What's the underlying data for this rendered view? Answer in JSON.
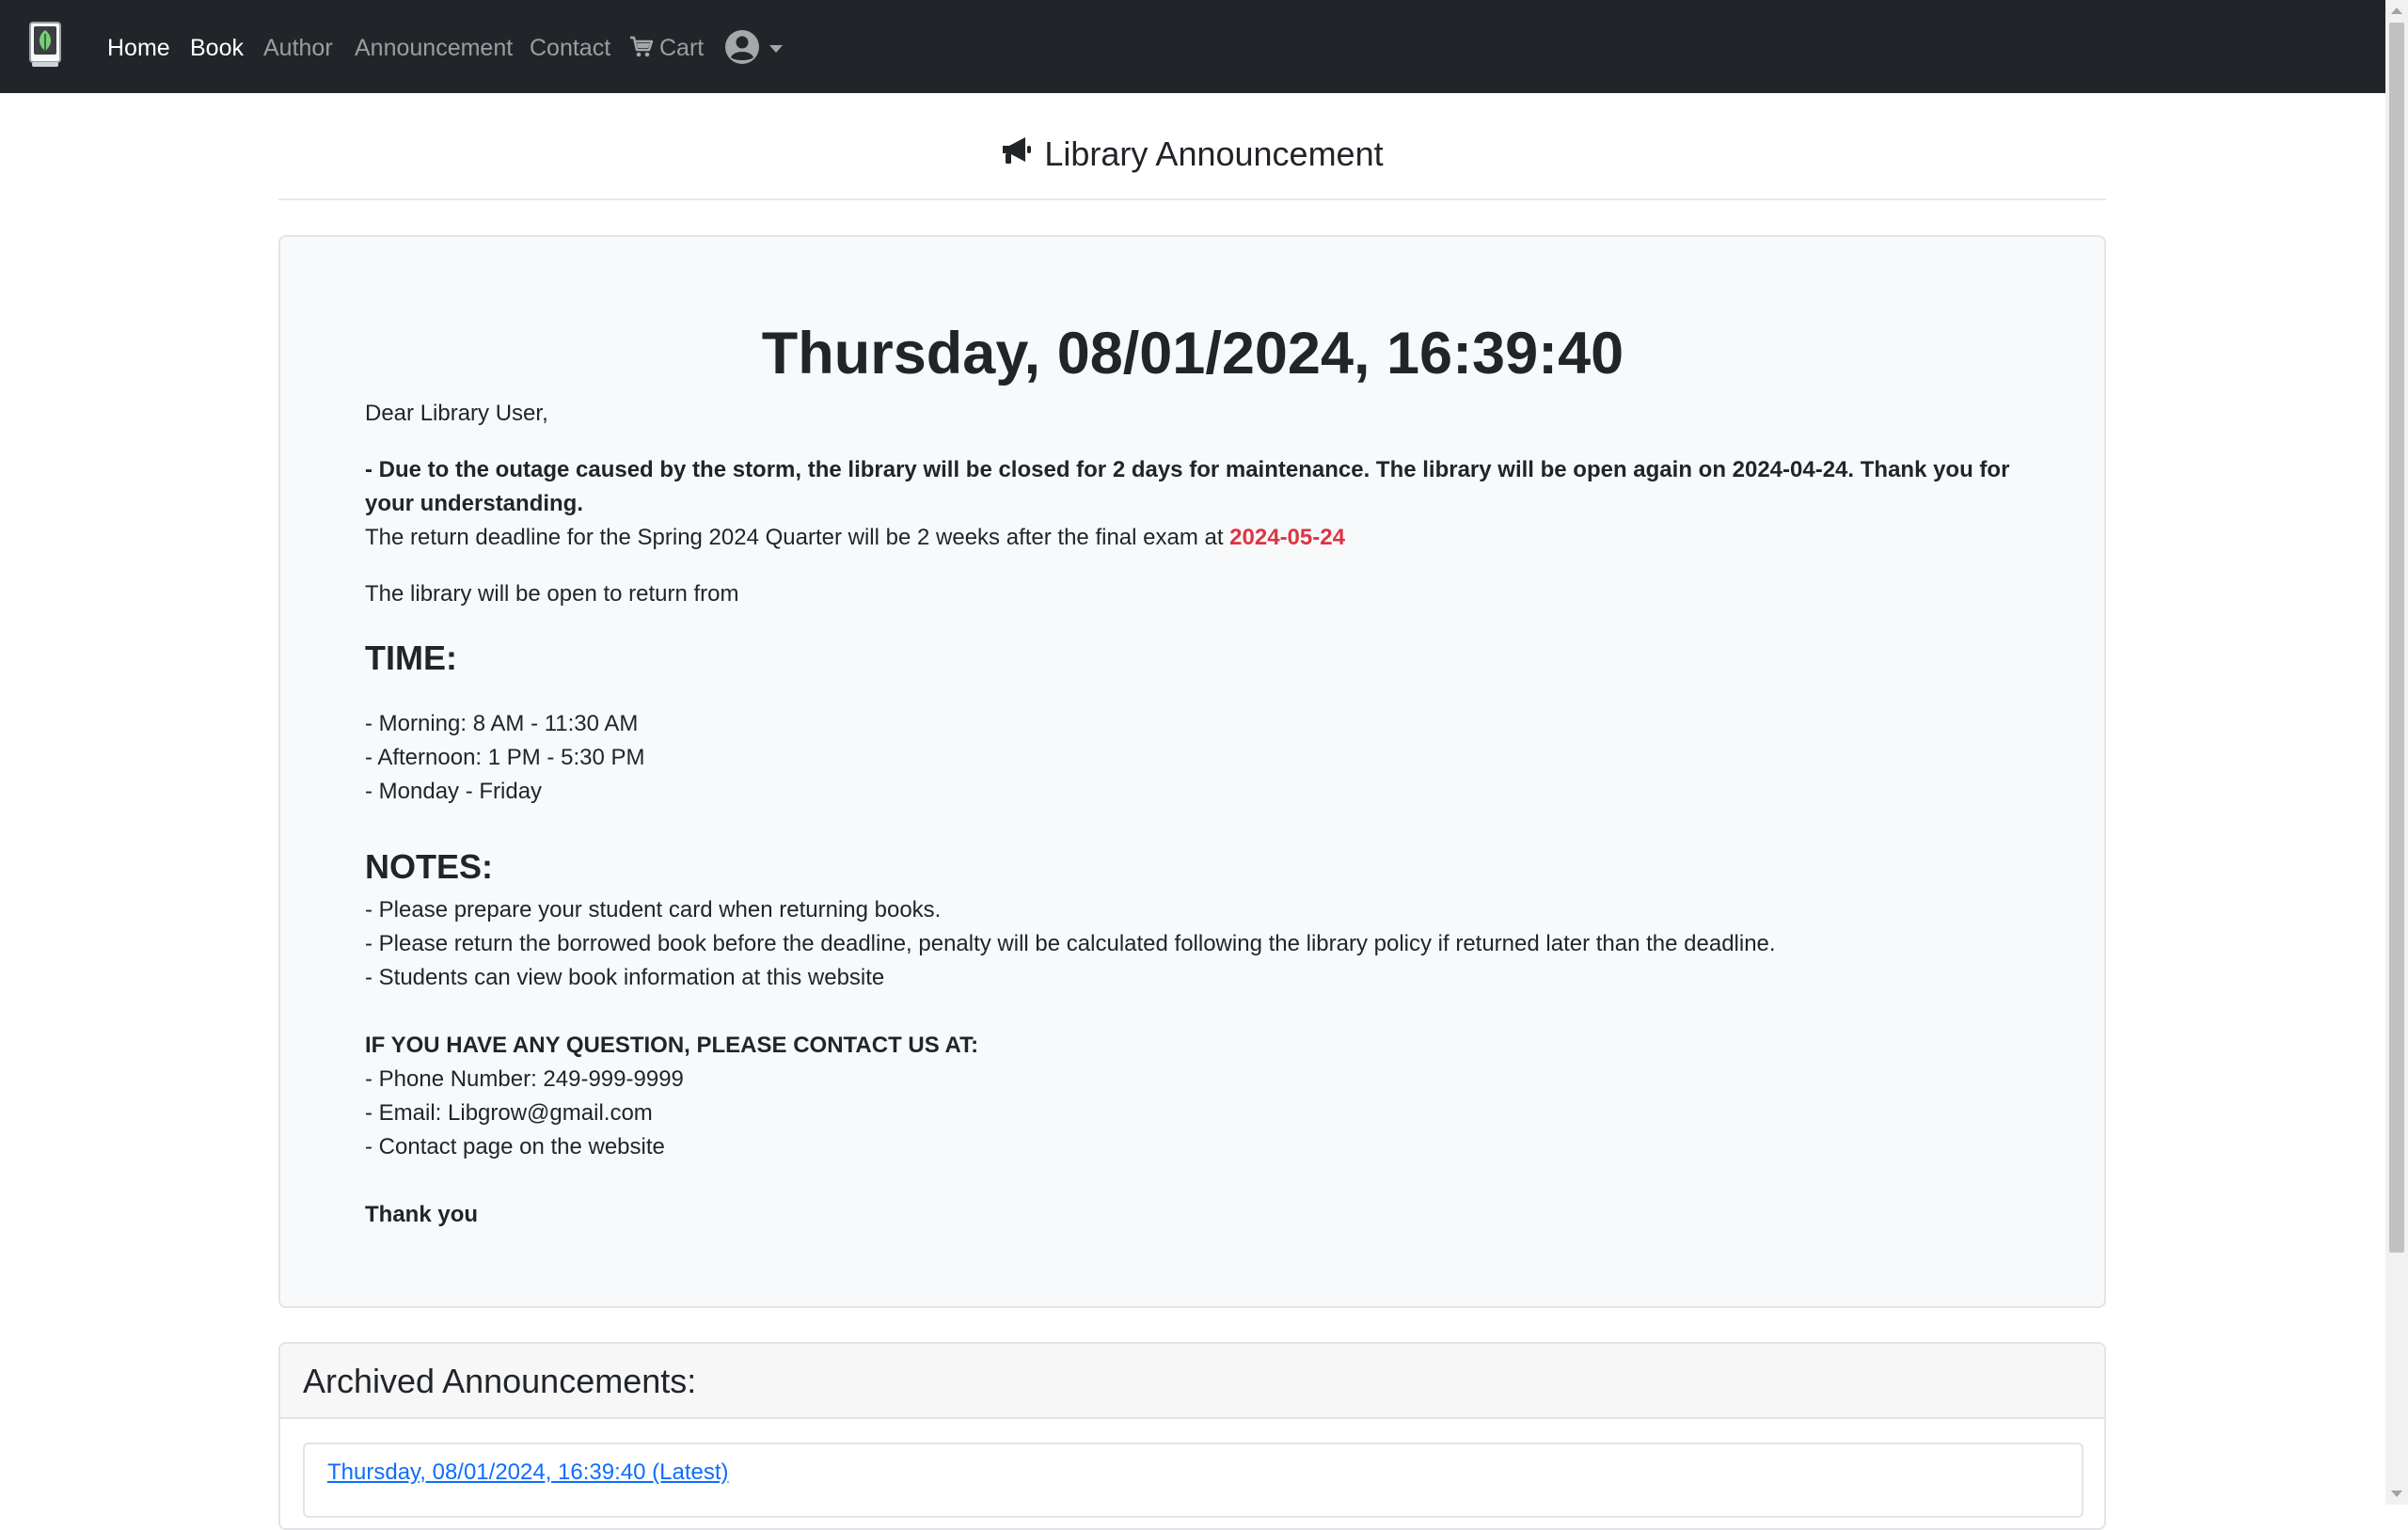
{
  "nav": {
    "items": [
      "Home",
      "Book",
      "Author",
      "Announcement",
      "Contact"
    ],
    "cart_label": "Cart"
  },
  "page": {
    "title": "Library Announcement"
  },
  "announcement": {
    "datetime": "Thursday, 08/01/2024, 16:39:40",
    "greeting": "Dear Library User,",
    "notice": "- Due to the outage caused by the storm, the library will be closed for 2 days for maintenance. The library will be open again on 2024-04-24. Thank you for your understanding.",
    "deadline_text": "The return deadline for the Spring 2024 Quarter will be 2 weeks after the final exam at ",
    "deadline_date": "2024-05-24",
    "open_text": "The library will be open to return from",
    "time_heading": "TIME:",
    "time_lines": [
      "- Morning: 8 AM - 11:30 AM",
      "- Afternoon: 1 PM - 5:30 PM",
      "- Monday - Friday"
    ],
    "notes_heading": "NOTES:",
    "notes_lines": [
      "- Please prepare your student card when returning books.",
      "- Please return the borrowed book before the deadline, penalty will be calculated following the library policy if returned later than the deadline.",
      "- Students can view book information at this website"
    ],
    "contact_heading": "IF YOU HAVE ANY QUESTION, PLEASE CONTACT US AT:",
    "contact_lines": [
      "- Phone Number: 249-999-9999",
      "- Email: Libgrow@gmail.com",
      "- Contact page on the website"
    ],
    "closing": "Thank you"
  },
  "archive": {
    "title": "Archived Announcements:",
    "items": [
      "Thursday, 08/01/2024, 16:39:40 (Latest)"
    ]
  },
  "colors": {
    "navbar_bg": "#212529",
    "accent_red": "#dc3545",
    "link_blue": "#0d6efd"
  }
}
